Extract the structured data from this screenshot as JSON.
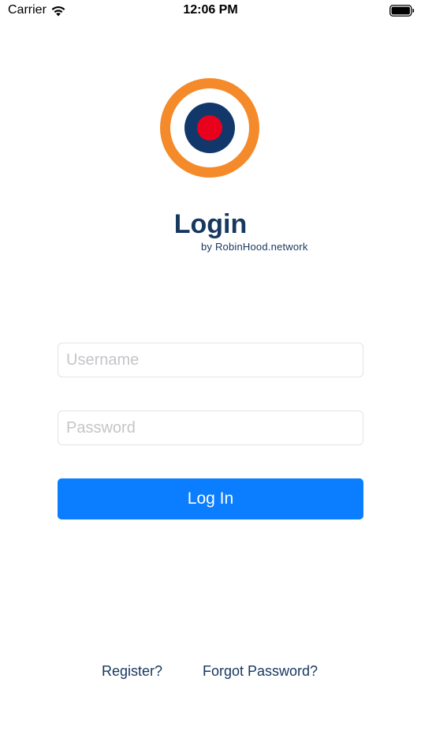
{
  "status_bar": {
    "carrier": "Carrier",
    "time": "12:06 PM"
  },
  "icons": {
    "wifi": "wifi-icon",
    "battery": "battery-icon",
    "logo": "target-logo-icon"
  },
  "header": {
    "title": "Login",
    "subtitle": "by RobinHood.network"
  },
  "form": {
    "username_placeholder": "Username",
    "username_value": "",
    "password_placeholder": "Password",
    "password_value": "",
    "login_label": "Log In"
  },
  "footer": {
    "register_label": "Register?",
    "forgot_label": "Forgot Password?"
  },
  "colors": {
    "primary_button": "#0b7dff",
    "brand_text": "#16375f",
    "logo_orange": "#f48a2a",
    "logo_navy": "#12376b",
    "logo_red": "#e8001c"
  }
}
